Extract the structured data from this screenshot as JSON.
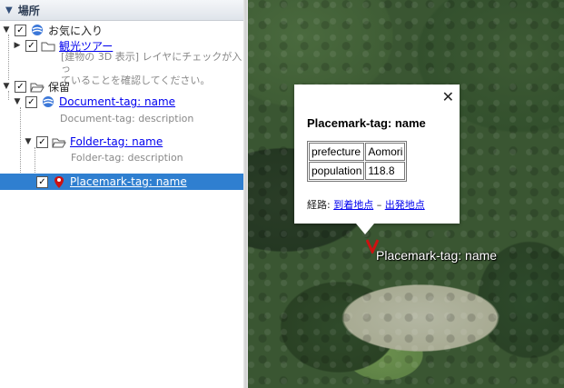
{
  "panel": {
    "title": "場所"
  },
  "tree": {
    "favorites": {
      "label": "お気に入り"
    },
    "tour": {
      "label": "観光ツアー",
      "desc_line1": "[建物の 3D 表示] レイヤにチェックが入っ",
      "desc_line2": "ていることを確認してください。"
    },
    "saved": {
      "label": "保留"
    },
    "document": {
      "label": "Document-tag: name",
      "desc": "Document-tag: description"
    },
    "folder": {
      "label": "Folder-tag: name",
      "desc": "Folder-tag: description"
    },
    "placemark": {
      "label": "Placemark-tag: name"
    }
  },
  "balloon": {
    "title": "Placemark-tag: name",
    "table": [
      [
        "prefecture",
        "Aomori"
      ],
      [
        "population",
        "118.8"
      ]
    ],
    "route_prefix": "経路: ",
    "to_here": "到着地点",
    "separator": " – ",
    "from_here": "出発地点",
    "close": "✕"
  },
  "map": {
    "placemark_label": "Placemark-tag: name"
  },
  "colors": {
    "selection": "#2f7fd0",
    "link": "#0000ee",
    "pin": "#cc1111"
  }
}
